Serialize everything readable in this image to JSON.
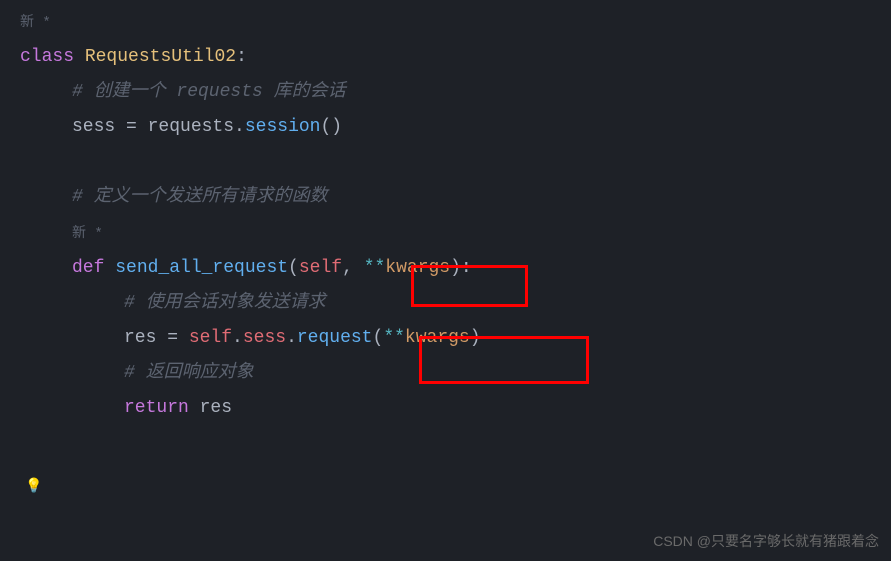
{
  "code": {
    "hint1": "新 *",
    "line1": {
      "kw": "class",
      "name": "RequestsUtil02",
      "colon": ":"
    },
    "line2": "# 创建一个 requests 库的会话",
    "line3": {
      "var": "sess",
      "eq": " = ",
      "call": "requests",
      "dot": ".",
      "method": "session",
      "parens": "()"
    },
    "line4": "# 定义一个发送所有请求的函数",
    "hint2": "新 *",
    "line5": {
      "kw": "def",
      "name": "send_all_request",
      "open": "(",
      "self": "self",
      "comma": ", ",
      "star": "**",
      "kwargs": "kwargs",
      "close": ")",
      "colon": ":"
    },
    "line6": "# 使用会话对象发送请求",
    "line7": {
      "var": "res",
      "eq": " = ",
      "self": "self",
      "dot": ".",
      "sess": "sess",
      "dot2": ".",
      "method": "request",
      "open": "(",
      "star": "**",
      "kwargs": "kwargs",
      "close": ")"
    },
    "line8": "# 返回响应对象",
    "line9": {
      "kw": "return",
      "val": "res"
    }
  },
  "watermark": "CSDN @只要名字够长就有猪跟着念",
  "bulb": "💡"
}
